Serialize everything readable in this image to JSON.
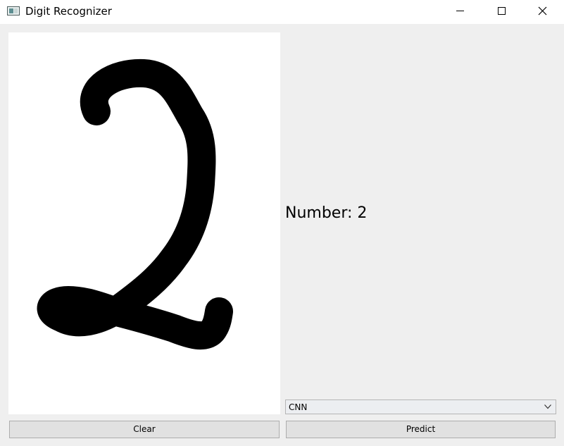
{
  "window": {
    "title": "Digit Recognizer"
  },
  "result": {
    "text": "Number: 2"
  },
  "model_select": {
    "selected": "CNN"
  },
  "buttons": {
    "clear": "Clear",
    "predict": "Predict"
  },
  "colors": {
    "window_bg": "#efefef",
    "canvas_bg": "#ffffff",
    "stroke": "#000000",
    "button_bg": "#e1e1e1"
  },
  "icons": {
    "minimize": "minimize-icon",
    "maximize": "maximize-icon",
    "close": "close-icon",
    "dropdown": "chevron-down-icon"
  }
}
